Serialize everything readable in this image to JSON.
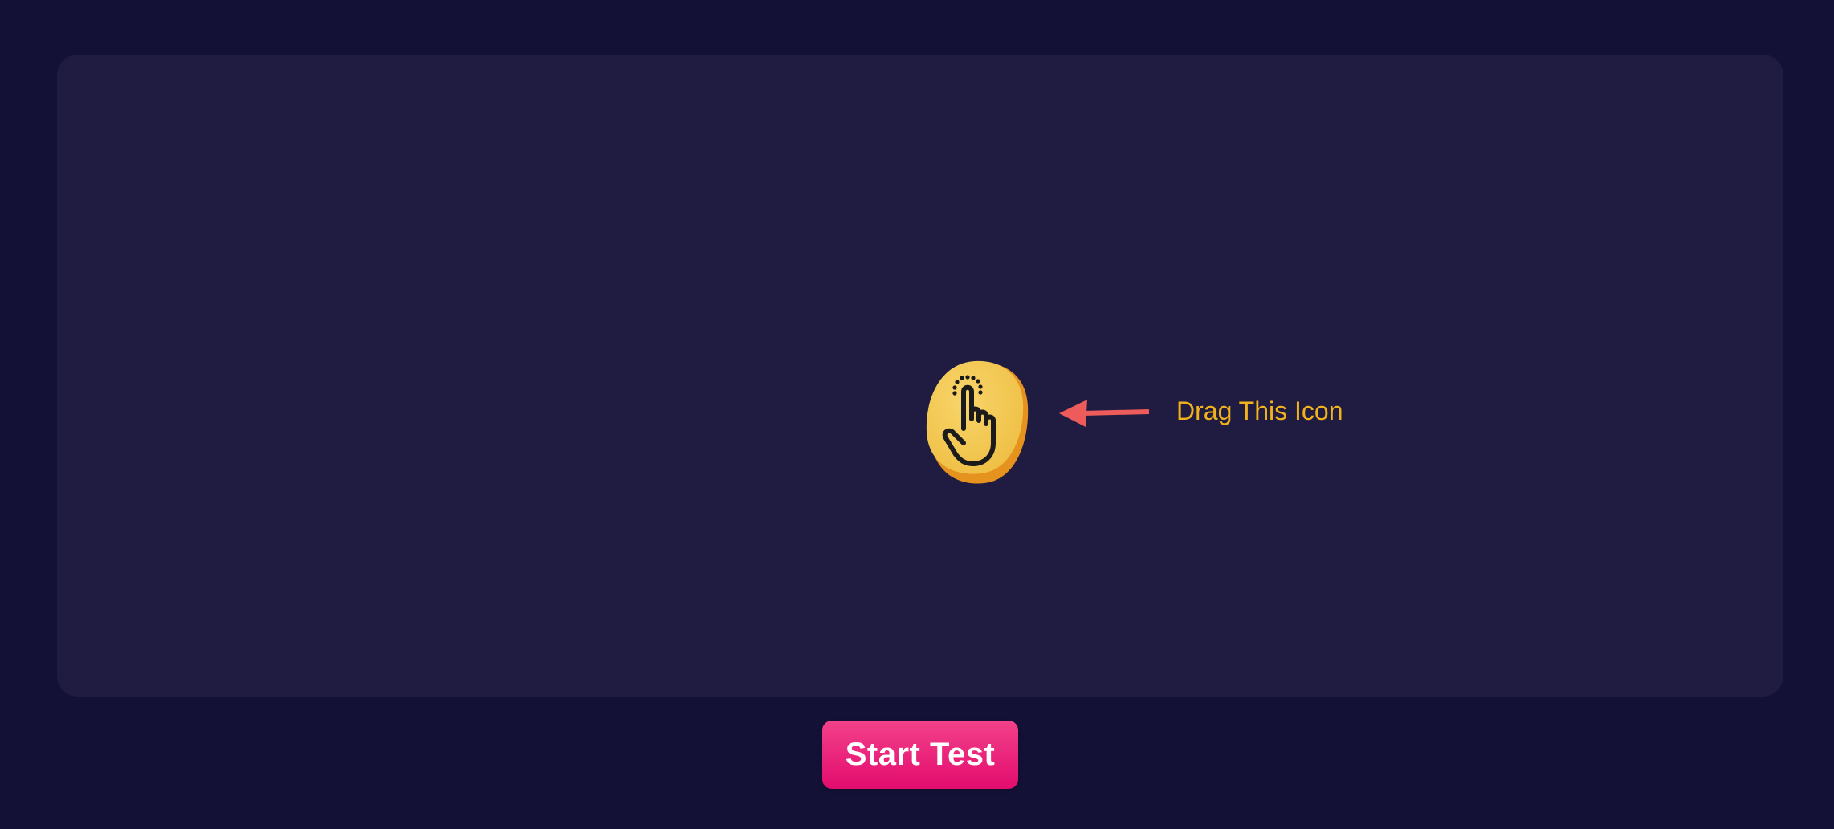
{
  "drag_area": {
    "icon": "tap-hand-icon",
    "hint_arrow": "arrow-left-icon",
    "hint_text": "Drag This Icon"
  },
  "controls": {
    "start_label": "Start Test"
  },
  "colors": {
    "page_background": "#141137",
    "panel_background": "#201c41",
    "hint_text": "#f2b21b",
    "arrow": "#ee5b5b",
    "icon_fill": "#f2c24c",
    "icon_shadow": "#e6921f",
    "button": "#e8146f"
  }
}
